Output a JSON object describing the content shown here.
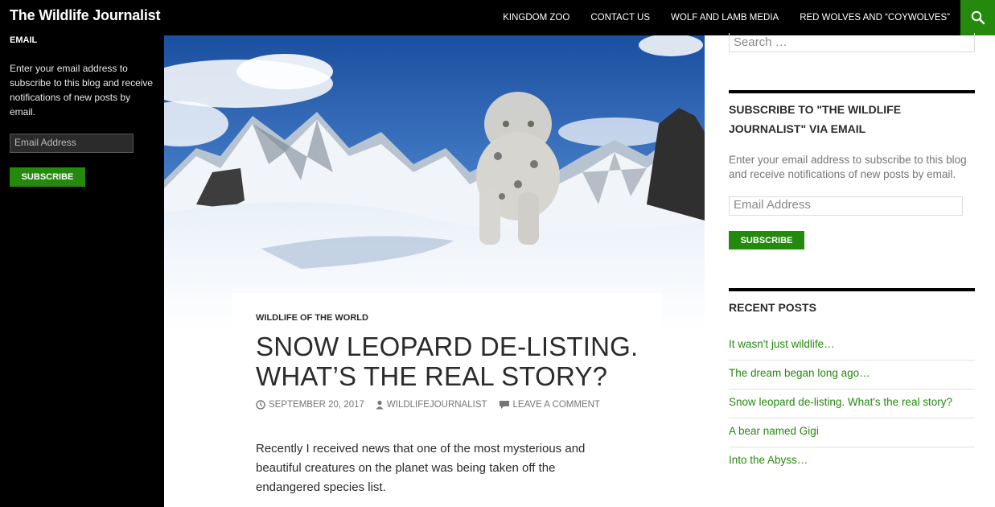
{
  "header": {
    "site_title": "The Wildlife Journalist",
    "nav": [
      "KINGDOM ZOO",
      "CONTACT US",
      "WOLF AND LAMB MEDIA",
      "RED WOLVES AND “COYWOLVES”"
    ],
    "search_icon": "search-icon",
    "accent_color": "#24890d"
  },
  "left_sidebar": {
    "heading": "EMAIL",
    "description": "Enter your email address to subscribe to this blog and receive notifications of new posts by email.",
    "email_placeholder": "Email Address",
    "subscribe_label": "SUBSCRIBE"
  },
  "post": {
    "category": "WILDLIFE OF THE WORLD",
    "title": "SNOW LEOPARD DE-LISTING. WHAT’S THE REAL STORY?",
    "date": "SEPTEMBER 20, 2017",
    "author": "WILDLIFEJOURNALIST",
    "comments": "LEAVE A COMMENT",
    "excerpt": "Recently I received news that one of the most mysterious and beautiful creatures on the planet was being taken off the endangered species list."
  },
  "right_sidebar": {
    "search_placeholder": "Search …",
    "subscribe_widget": {
      "title": "SUBSCRIBE TO \"THE WILDLIFE JOURNALIST\" VIA EMAIL",
      "description": "Enter your email address to subscribe to this blog and receive notifications of new posts by email.",
      "email_placeholder": "Email Address",
      "subscribe_label": "SUBSCRIBE"
    },
    "recent_posts": {
      "title": "RECENT POSTS",
      "items": [
        "It wasn't just wildlife…",
        "The dream began long ago…",
        "Snow leopard de-listing. What's the real story?",
        "A bear named Gigi",
        "Into the Abyss…"
      ]
    }
  }
}
